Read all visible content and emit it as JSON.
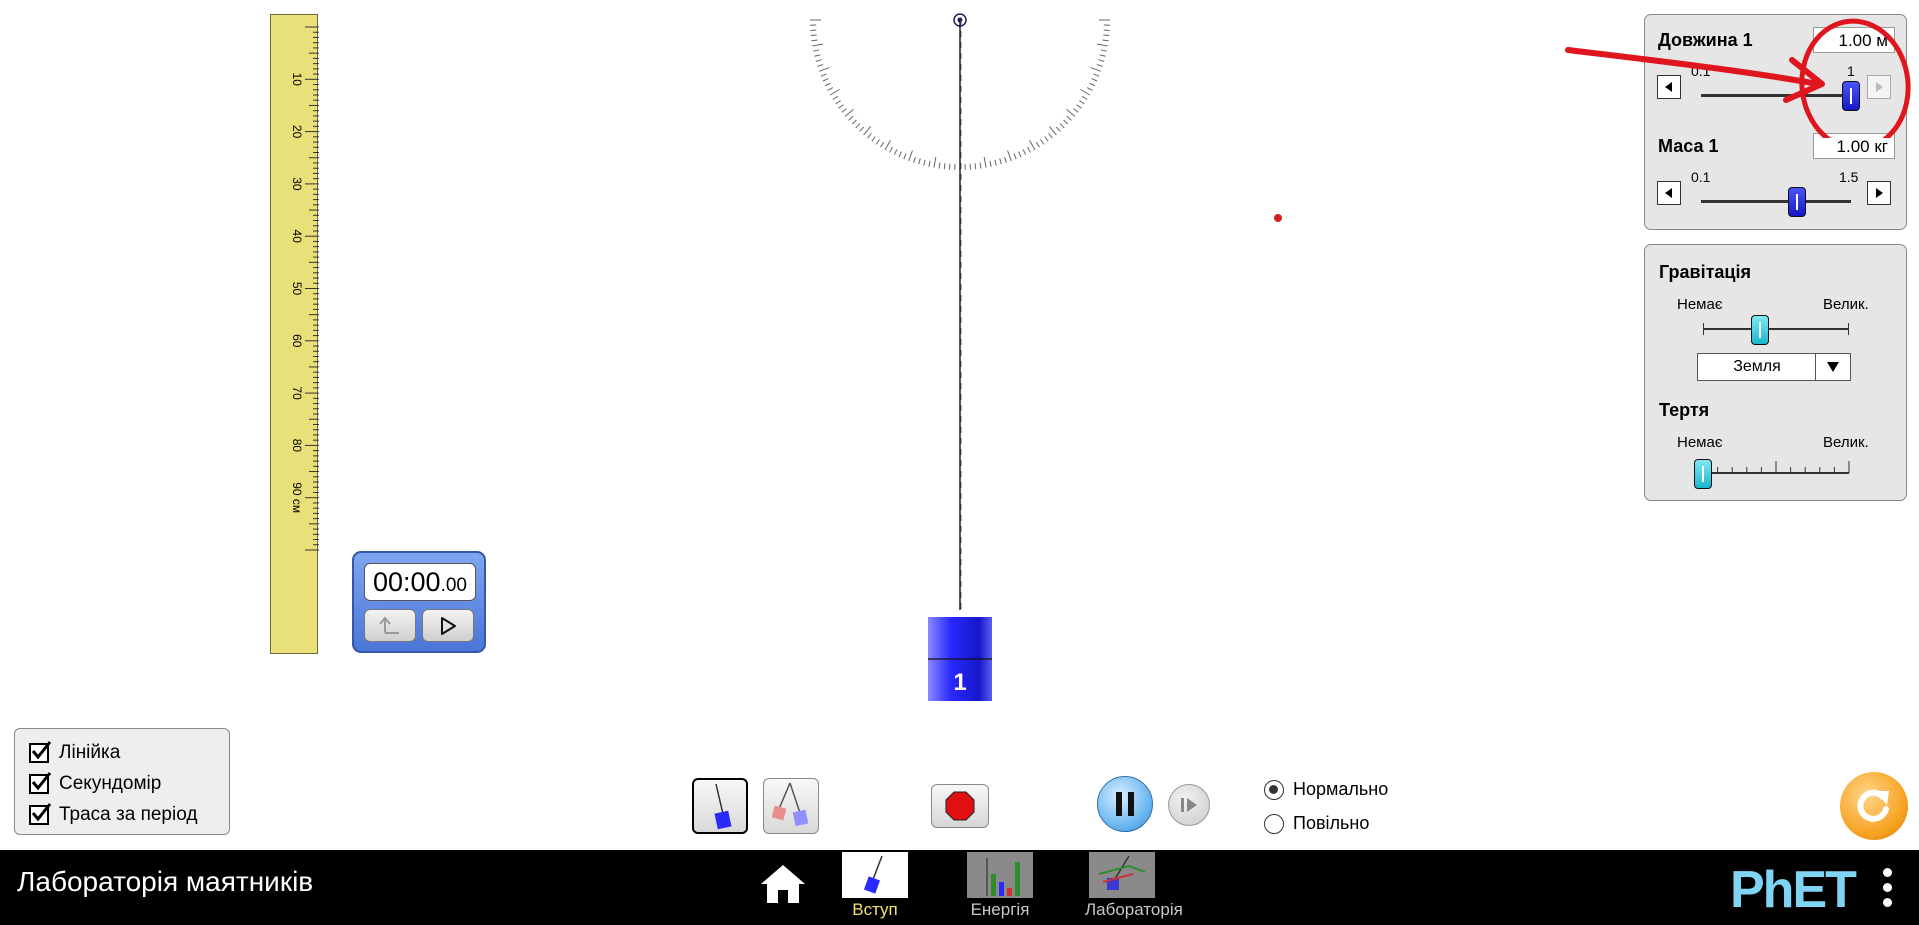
{
  "ruler": {
    "labels": [
      "10",
      "20",
      "30",
      "40",
      "50",
      "60",
      "70",
      "80",
      "90 см"
    ]
  },
  "stopwatch": {
    "time_main": "00:00",
    "time_fraction": ".00"
  },
  "pendulum": {
    "mass_label": "1"
  },
  "visibility": {
    "ruler_label": "Лінійка",
    "stopwatch_label": "Секундомір",
    "trace_label": "Траса за період"
  },
  "length": {
    "title": "Довжина 1",
    "value": "1.00 м",
    "min_label": "0.1",
    "max_label": "1",
    "fraction": 1.0
  },
  "mass": {
    "title": "Маса 1",
    "value": "1.00 кг",
    "min_label": "0.1",
    "max_label": "1.5",
    "fraction": 0.64
  },
  "gravity": {
    "title": "Гравітація",
    "min_label": "Немає",
    "max_label": "Велик.",
    "selected": "Земля",
    "fraction": 0.39
  },
  "friction": {
    "title": "Тертя",
    "min_label": "Немає",
    "max_label": "Велик.",
    "fraction": 0.0
  },
  "speed": {
    "normal_label": "Нормально",
    "slow_label": "Повільно",
    "selected": "normal"
  },
  "nav": {
    "title": "Лабораторія маятників",
    "tabs": [
      "Вступ",
      "Енергія",
      "Лабораторія"
    ],
    "active_tab": "Вступ",
    "logo": "PhET"
  },
  "colors": {
    "annotation": "#e0161e",
    "mass_blue": "#2323e6",
    "slider_cyan": "#24c1d6"
  }
}
